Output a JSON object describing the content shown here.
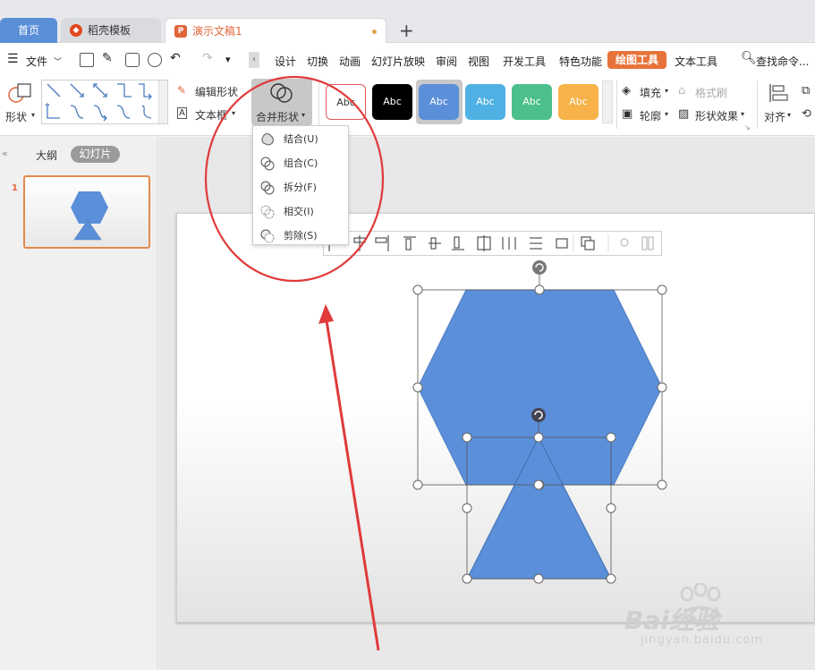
{
  "tabs": {
    "home": "首页",
    "template": "稻壳模板",
    "document": "演示文稿1",
    "new_tab": "+"
  },
  "menubar": {
    "file": "文件",
    "items": [
      "设计",
      "切换",
      "动画",
      "幻灯片放映",
      "审阅",
      "视图",
      "开发工具",
      "特色功能"
    ],
    "drawing_tools": "绘图工具",
    "text_tools": "文本工具",
    "search": "查找命令..."
  },
  "ribbon": {
    "shape": "形状",
    "edit_shape": "编辑形状",
    "text_box": "文本框",
    "merge_shapes": "合并形状",
    "swatch_label": "Abc",
    "fill": "填充",
    "format_painter": "格式刷",
    "outline": "轮廓",
    "shape_effects": "形状效果",
    "align": "对齐"
  },
  "merge_menu": [
    "结合(U)",
    "组合(C)",
    "拆分(F)",
    "相交(I)",
    "剪除(S)"
  ],
  "leftpanel": {
    "outline_tab": "大纲",
    "slides_tab": "幻灯片",
    "slide_number": "1"
  },
  "watermark": {
    "brand": "Bai经验",
    "url": "jingyan.baidu.com"
  },
  "colors": {
    "accent_orange": "#e8733a",
    "shape_blue": "#5b8fd9",
    "annotation_red": "#e03a3a",
    "swatches": [
      "#ffffff",
      "#000000",
      "#5b8fd9",
      "#4fb1e3",
      "#4cc08a",
      "#f7b34a"
    ]
  }
}
